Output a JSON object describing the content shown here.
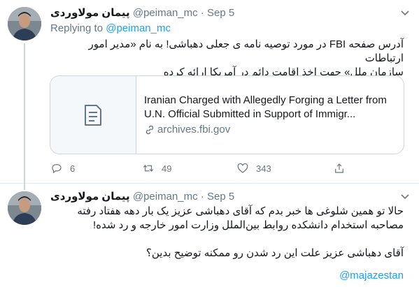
{
  "tweets": [
    {
      "display_name": "پیمان مولاوردی",
      "handle": "@peiman_mc",
      "date": "Sep 5",
      "replying_to_label": "Replying to",
      "replying_to_handle": "@peiman_mc",
      "text_lines": [
        "آدرس صفحه FBI در مورد توصیه نامه ی جعلی دهباشی! به نام «مدیر امور ارتباطات",
        "سازمان ملل» جهت اخذ اقامت دائم در آمریکا ارائه کرده"
      ],
      "card": {
        "title": "Iranian Charged with Allegedly Forging a Letter from\nU.N. Official Submitted in Support of Immigr...",
        "domain": "archives.fbi.gov",
        "thumb_icon": "document-icon"
      },
      "actions": {
        "replies": "6",
        "retweets": "49",
        "likes": "343"
      }
    },
    {
      "display_name": "پیمان مولاوردی",
      "handle": "@peiman_mc",
      "date": "Sep 5",
      "text_lines": [
        "حالا تو همین شلوغی ها خبر بدم که آقای دهباشی عزیز یک بار دهه هفتاد رفته",
        "مصاحبه استخدام دانشکده روابط بین‌الملل وزارت امور خارجه و رد شده!",
        "",
        "آقای دهباشی عزیز علت این رد شدن رو ممکنه توضیح بدین؟"
      ],
      "signature": "@majazestan"
    }
  ],
  "colors": {
    "accent": "#1da1f2",
    "muted": "#657786",
    "border": "#e6ecf0",
    "text": "#14171a"
  }
}
